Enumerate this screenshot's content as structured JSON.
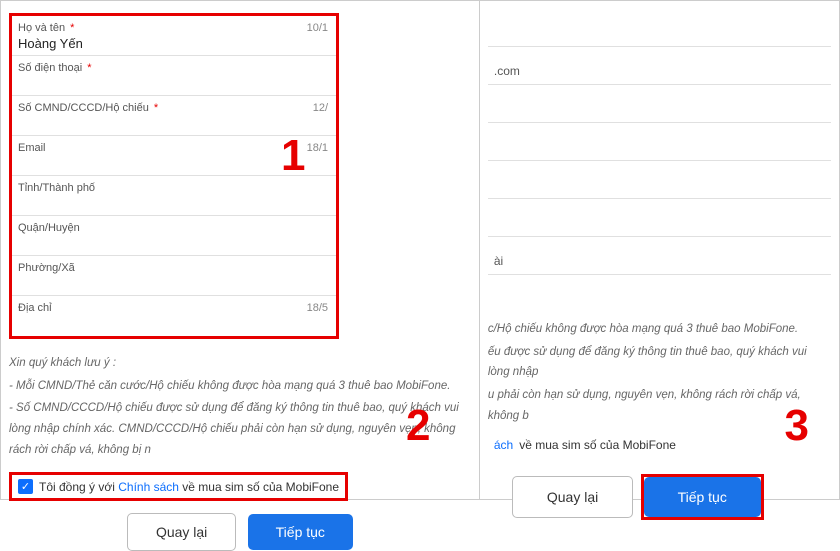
{
  "left": {
    "fields": {
      "name": {
        "label": "Họ và tên",
        "required": true,
        "value": "Hoàng Yến",
        "rdate": "10/1"
      },
      "phone": {
        "label": "Số điện thoại",
        "required": true,
        "value": "",
        "rdate": ""
      },
      "idnum": {
        "label": "Số CMND/CCCD/Hộ chiếu",
        "required": true,
        "value": "",
        "rdate": "12/"
      },
      "email": {
        "label": "Email",
        "required": false,
        "value": "",
        "rdate": "18/1"
      },
      "province": {
        "label": "Tỉnh/Thành phố",
        "required": false,
        "value": "",
        "rdate": ""
      },
      "district": {
        "label": "Quận/Huyện",
        "required": false,
        "value": "",
        "rdate": ""
      },
      "ward": {
        "label": "Phường/Xã",
        "required": false,
        "value": "",
        "rdate": ""
      },
      "address": {
        "label": "Địa chỉ",
        "required": false,
        "value": "",
        "rdate": "18/5"
      }
    },
    "notes": {
      "header": "Xin quý khách lưu ý :",
      "n1": "- Mỗi CMND/Thẻ căn cước/Hộ chiếu không được hòa mạng quá 3 thuê bao MobiFone.",
      "n2": "- Số CMND/CCCD/Hộ chiếu được sử dụng để đăng ký thông tin thuê bao, quý khách vui lòng nhập chính xác. CMND/CCCD/Hộ chiếu phải còn hạn sử dụng, nguyên vẹn, không rách rời chấp vá, không bị n"
    },
    "consent": {
      "pre": "Tôi đồng ý với",
      "link": "Chính sách",
      "post": "về mua sim số của MobiFone",
      "checked": true
    },
    "buttons": {
      "back": "Quay lại",
      "next": "Tiếp tục"
    }
  },
  "right": {
    "partial": {
      "com": ".com",
      "ai": "ài"
    },
    "notes": {
      "l1": "c/Hộ chiếu không được hòa mạng quá 3 thuê bao MobiFone.",
      "l2": "ếu được sử dụng để đăng ký thông tin thuê bao, quý khách vui lòng nhập",
      "l3": "u phải còn hạn sử dụng, nguyên vẹn, không rách rời chấp vá, không b"
    },
    "consent": {
      "link": "ách",
      "post": "về mua sim số của MobiFone"
    },
    "buttons": {
      "back": "Quay lại",
      "next": "Tiếp tục"
    }
  },
  "steps": {
    "s1": "1",
    "s2": "2",
    "s3": "3"
  },
  "required_star": "*",
  "checkmark": "✓"
}
